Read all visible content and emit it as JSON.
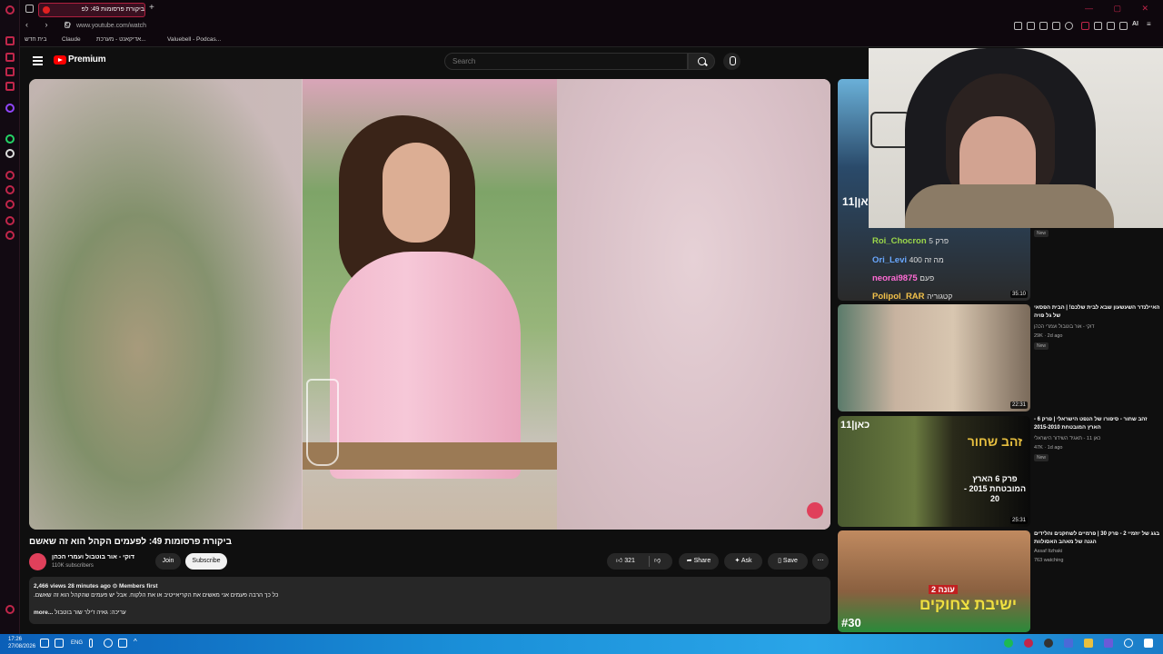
{
  "browser": {
    "tab_title": "ביקורת פרסומות 49: לפ",
    "url": "www.youtube.com/watch",
    "bookmarks": [
      "בית חדש",
      "Claude",
      "אדיקאנט - מערכת...",
      "Valuebell - Podcas..."
    ],
    "ai_label": "AI"
  },
  "youtube": {
    "logo_text": "Premium",
    "search_placeholder": "Search"
  },
  "video": {
    "title": "ביקורת פרסומות 49: לפעמים הקהל הוא זה שאשם",
    "channel": "דוקי - אור בוטבול ועמרי הכהן",
    "subscribers": "110K subscribers",
    "join": "Join",
    "subscribe": "Subscribe",
    "likes": "321",
    "share": "Share",
    "ask": "Ask",
    "save": "Save",
    "description": {
      "meta": "2,466 views  28 minutes ago  ⊙ Members first",
      "line1": "כל כך הרבה פעמים אני מאשים את הקריאייטיב או את הלקוח. אבל יש פעמים שהקהל הוא זה שאשם.",
      "line2_prefix": "עריכה: גאיה ז'ילר שור בוטבול",
      "more": "...more"
    }
  },
  "chat": [
    {
      "user": "Roi_Chocron",
      "color": "#9bd64a",
      "msg": "פרק 5"
    },
    {
      "user": "Ori_Levi",
      "color": "#6aa8ff",
      "msg": "מה זה 400"
    },
    {
      "user": "neorai9875",
      "color": "#ff6bd5",
      "msg": "פעם"
    },
    {
      "user": "Polipol_RAR",
      "color": "#f2c14a",
      "msg": "קטגוריה"
    }
  ],
  "related": [
    {
      "title": "כאן 11",
      "duration": "35:10",
      "badge": "New",
      "channel": "",
      "meta": ""
    },
    {
      "title": "האיילנדר השעשעון שבא לבית שלכם! | הבית הפסאי של גל פויה",
      "channel": "דוקי - אור בוטבול ועמרי הכהן",
      "meta": "29K · 2d ago",
      "badge": "New",
      "duration": "22:31"
    },
    {
      "title": "זהב שחור - סיפורו של הנפט הישראלי | פרק 6 - הארץ המובטחת 2015-2010",
      "channel": "כאן 11 - תאגיד השידור הישראלי",
      "meta": "47K · 1d ago",
      "badge": "New",
      "duration": "25:31"
    },
    {
      "title": "בגג של יוזמיי 2 - פרק 30 | פרמיים לשחקנים והלידים הגנה של מאהב האסולוות",
      "channel": "Assaf Itzhaki",
      "meta": "763 watching",
      "badge": "",
      "duration": ""
    }
  ],
  "thumb_labels": {
    "kan": "כאן|11",
    "black_gold_top": "זהב שחור",
    "black_gold_sub": "פרק 6 הארץ המובטחת 2015 - 20",
    "yeshivat": "ישיבת צחוקים",
    "season": "עונה 2",
    "episode": "#30"
  },
  "taskbar": {
    "time": "17:26",
    "date": "27/08/2026",
    "lang": "ENG"
  }
}
